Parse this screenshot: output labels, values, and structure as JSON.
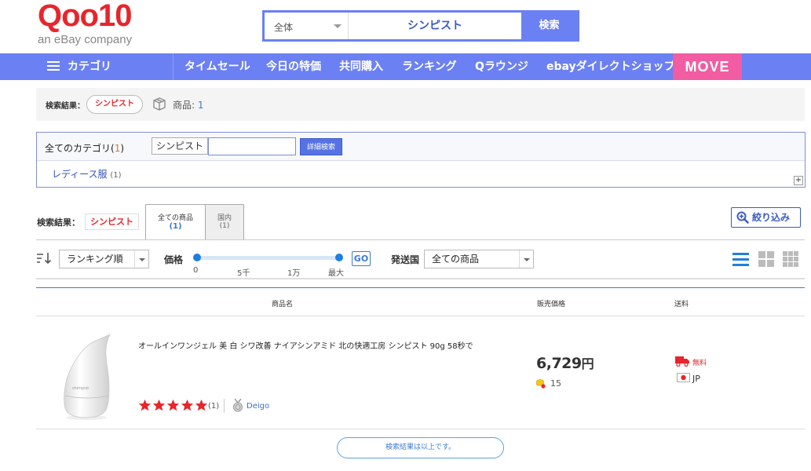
{
  "header": {
    "logo_text": "Qoo10",
    "logo_sub": "an eBay company",
    "search_category": "全体",
    "search_query": "シンピスト",
    "search_button": "検索"
  },
  "nav": {
    "category_label": "カテゴリ",
    "items": [
      "タイムセール",
      "今日の特価",
      "共同購入",
      "ランキング",
      "Qラウンジ",
      "ebayダイレクトショップ"
    ],
    "move_label": "MOVE"
  },
  "result_bar": {
    "label": "検索結果：",
    "keyword": "シンピスト",
    "product_label": "商品:",
    "product_count": "1"
  },
  "category_box": {
    "all_label": "全てのカテゴリ(",
    "all_count": "1",
    "all_close": ")",
    "keyword_tag": "シンピスト",
    "detail_search": "詳細検索",
    "category": "レディース服",
    "category_count": "(1)",
    "expand": "+"
  },
  "tabs_bar": {
    "label": "検索結果：",
    "keyword": "シンピスト",
    "tabs": [
      {
        "label": "全ての商品",
        "count": "(1)"
      },
      {
        "label": "国内",
        "count": "(1)"
      }
    ],
    "filter_button": "絞り込み"
  },
  "controls": {
    "sort_value": "ランキング順",
    "price_label": "価格",
    "price_ticks": [
      "0",
      "5千",
      "1万",
      "最大"
    ],
    "price_min_fraction": 0,
    "price_max_fraction": 1,
    "go_button": "GO",
    "ship_label": "発送国",
    "ship_value": "全ての商品"
  },
  "table": {
    "headers": [
      "商品名",
      "販売価格",
      "送料"
    ],
    "products": [
      {
        "name": "オールインワンジェル 美 白 シワ改善 ナイアシンアミド 北の快適工房 シンピスト 90g 58秒で",
        "price": "6,729",
        "currency": "円",
        "points": "15",
        "shipping": "無料",
        "country": "JP",
        "rating": 5,
        "review_count": "(1)",
        "seller": "Deigo"
      }
    ]
  },
  "end_message": "検索結果は以上です。",
  "colors": {
    "brand_red": "#e8252c",
    "nav_blue": "#6b80f2",
    "move_pink": "#f25ca2",
    "link_blue": "#3a7bd5"
  }
}
